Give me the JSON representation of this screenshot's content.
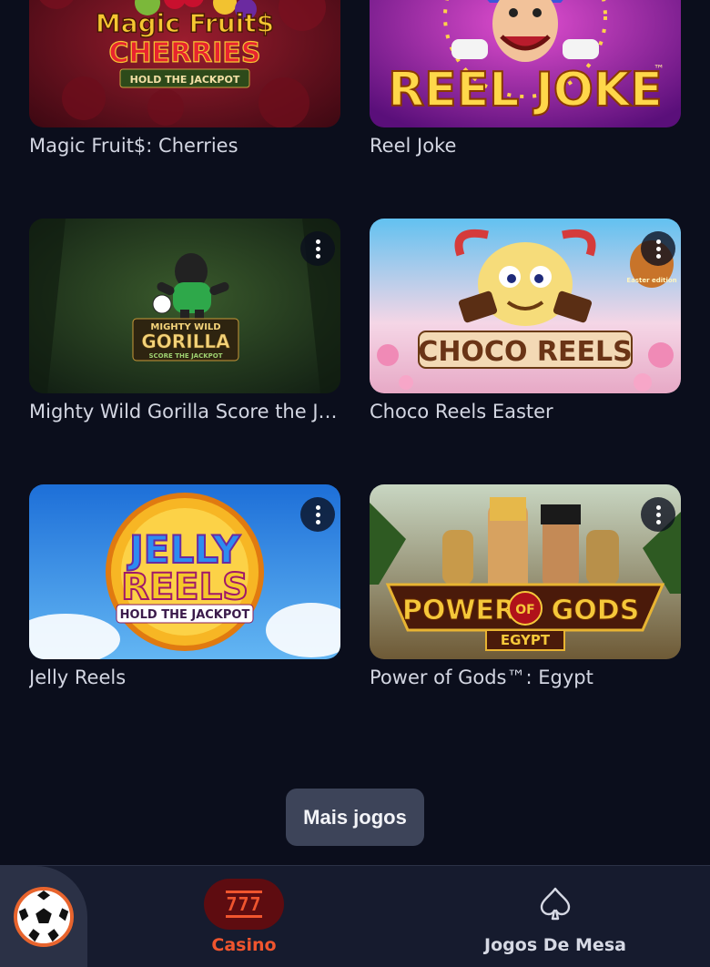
{
  "games": [
    {
      "title": "Magic Fruit$: Cherries",
      "art": [
        "Magic Fruit$",
        "CHERRIES",
        "HOLD THE JACKPOT"
      ]
    },
    {
      "title": "Reel Joke",
      "art": [
        "REEL JOKE",
        "™"
      ]
    },
    {
      "title": "Mighty Wild Gorilla Score the Jackpot",
      "art": [
        "MIGHTY WILD",
        "GORILLA",
        "SCORE THE JACKPOT"
      ]
    },
    {
      "title": "Choco Reels Easter",
      "art": [
        "CHOCO REELS",
        "Easter edition"
      ]
    },
    {
      "title": "Jelly Reels",
      "art": [
        "JELLY",
        "REELS",
        "HOLD THE JACKPOT"
      ]
    },
    {
      "title": "Power of Gods™: Egypt",
      "art": [
        "POWER",
        "OF",
        "GODS",
        "EGYPT"
      ]
    }
  ],
  "more_button": "Mais jogos",
  "bottom_nav": {
    "sport_icon": "soccer-ball-icon",
    "casino": {
      "icon_text": "777",
      "label": "Casino"
    },
    "table_games": {
      "icon": "spade-icon",
      "label": "Jogos De Mesa"
    }
  },
  "colors": {
    "accent": "#f0552e",
    "background": "#0b0e1c",
    "nav_bg": "#161b2e",
    "button_bg": "#3d4459"
  }
}
